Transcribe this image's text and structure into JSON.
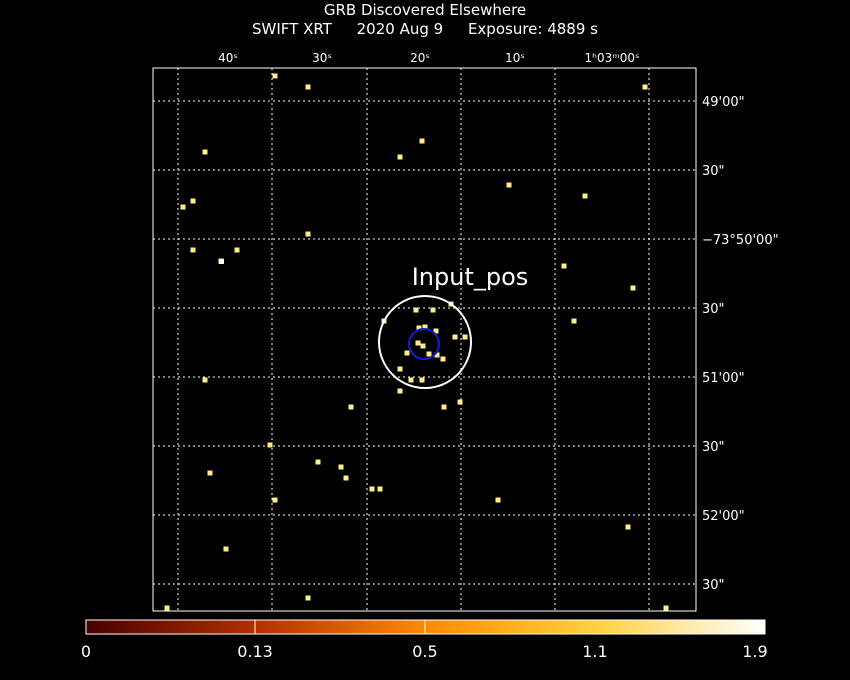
{
  "header": {
    "title": "GRB Discovered Elsewhere",
    "instrument": "SWIFT XRT",
    "date": "2020 Aug  9",
    "exposure": "Exposure: 4889 s"
  },
  "ra_ticks": [
    "40ˢ",
    "30ˢ",
    "20ˢ",
    "10ˢ",
    "1ʰ03ᵐ00ˢ"
  ],
  "dec_ticks": [
    "49'00\"",
    "30\"",
    "−73°50'00\"",
    "30\"",
    "51'00\"",
    "30\"",
    "52'00\"",
    "30\""
  ],
  "source_label": "Input_pos",
  "colorbar": {
    "labels": [
      "0",
      "0.13",
      "0.5",
      "1.1",
      "1.9"
    ],
    "colors": [
      "#ffffff",
      "#4a0000",
      "#ff8a00",
      "#ffd200",
      "#ffffff"
    ]
  },
  "photon_color": "#ffee88",
  "circle_colors": {
    "outer": "#ffffff",
    "inner": "#0000cc"
  }
}
